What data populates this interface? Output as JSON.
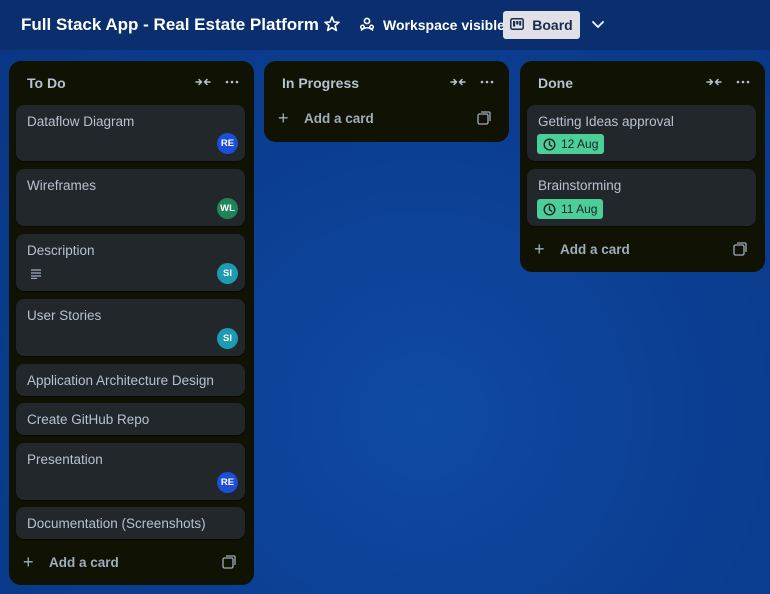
{
  "header": {
    "board_title": "Full Stack App - Real Estate Platform",
    "visibility": "Workspace visible",
    "view": "Board",
    "icons": [
      "star-icon",
      "workspace-visible-icon",
      "board-view-icon",
      "chevron-down-icon"
    ]
  },
  "lists": [
    {
      "title": "To Do",
      "add_card": "Add a card",
      "cards": [
        {
          "title": "Dataflow Diagram",
          "avatar": "RE"
        },
        {
          "title": "Wireframes",
          "avatar": "WL"
        },
        {
          "title": "Description",
          "avatar": "SI",
          "has_description": true
        },
        {
          "title": "User Stories",
          "avatar": "SI"
        },
        {
          "title": "Application Architecture Design"
        },
        {
          "title": "Create GitHub Repo"
        },
        {
          "title": "Presentation",
          "avatar": "RE"
        },
        {
          "title": "Documentation (Screenshots)"
        }
      ]
    },
    {
      "title": "In Progress",
      "add_card": "Add a card",
      "cards": []
    },
    {
      "title": "Done",
      "add_card": "Add a card",
      "cards": [
        {
          "title": "Getting Ideas approval",
          "due": "12 Aug"
        },
        {
          "title": "Brainstorming",
          "due": "11 Aug"
        }
      ]
    }
  ],
  "colors": {
    "avatar_RE": "#1d4ed8",
    "avatar_WL": "#1f845a",
    "avatar_SI": "#1d9bb0",
    "due_complete": "#4bce97",
    "list_bg": "#101204",
    "card_bg": "#22272b"
  }
}
